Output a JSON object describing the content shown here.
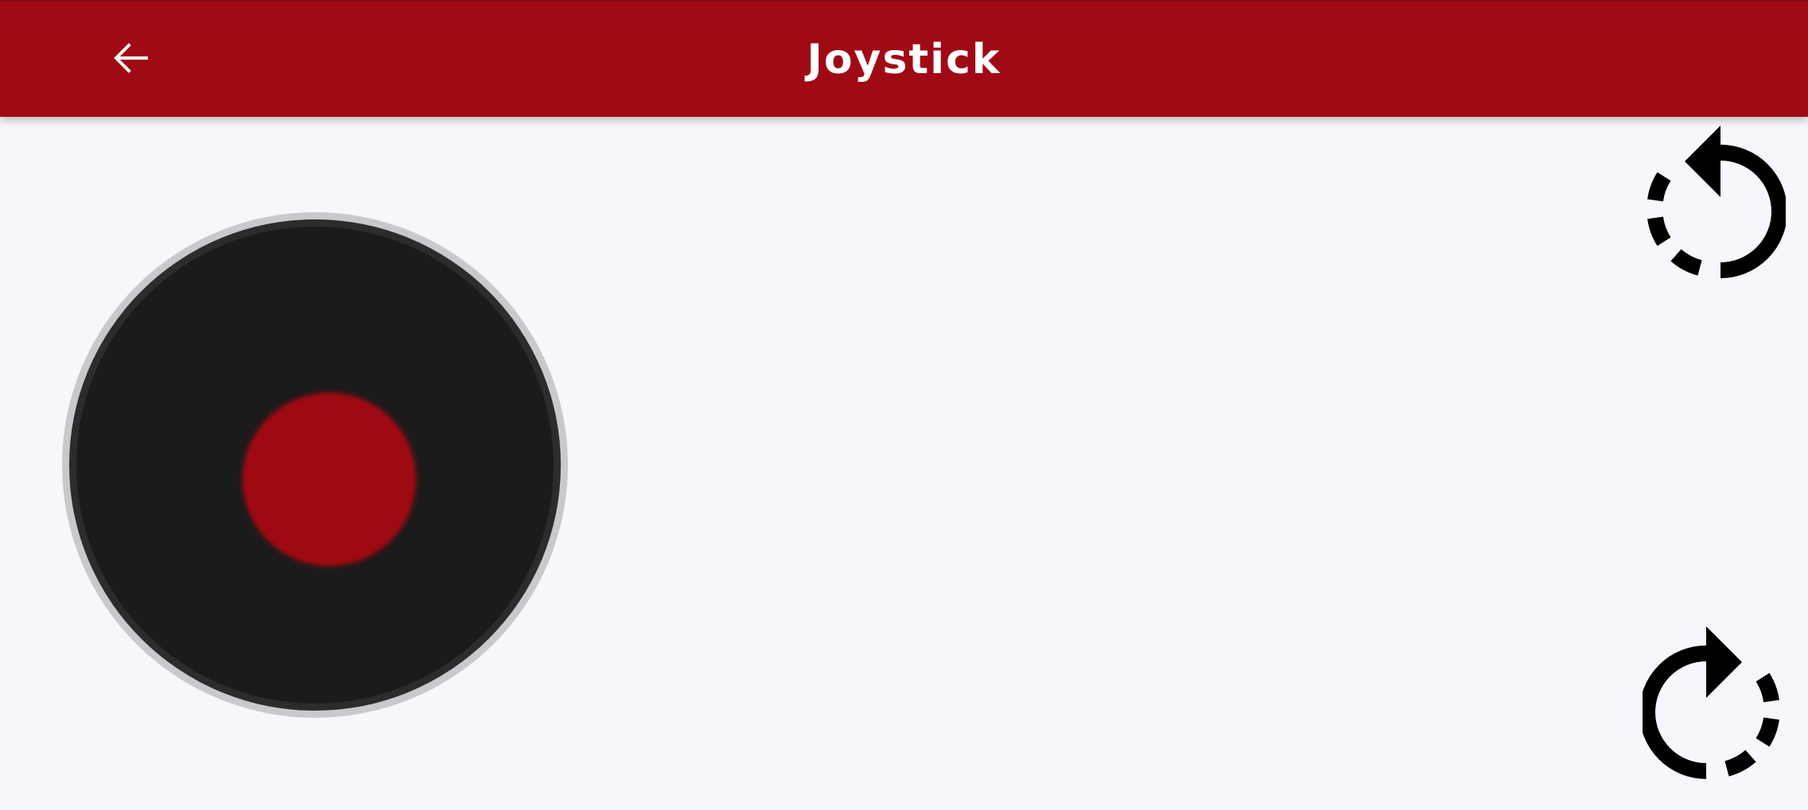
{
  "app_bar": {
    "title": "Joystick",
    "background_color": "#a00a14",
    "back_icon": "arrow-left-icon"
  },
  "joystick": {
    "base_color": "#1b1b1b",
    "knob_color": "#9f0a12",
    "knob_offset": {
      "x": 0,
      "y": 0
    }
  },
  "controls": {
    "rotate_left_icon": "rotate-counterclockwise-icon",
    "rotate_right_icon": "rotate-clockwise-icon"
  }
}
